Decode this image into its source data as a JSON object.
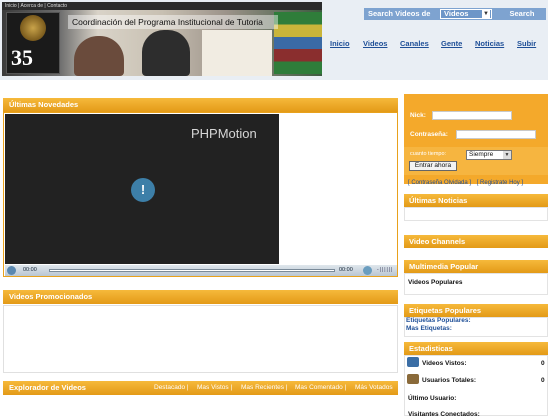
{
  "banner": {
    "top_strip": "Inicio | Acerca de | Contacto",
    "logo_number": "35",
    "title": "Coordinación del Programa Institucional de Tutoria"
  },
  "search": {
    "label": "Search Videos de",
    "selected": "Videos",
    "button": "Search"
  },
  "nav": [
    "Inicio",
    "Videos",
    "Canales",
    "Gente",
    "Noticias",
    "Subir"
  ],
  "main": {
    "novedades_title": "Últimas Novedades",
    "player": {
      "brand": "PHPMotion",
      "time_start": "00:00",
      "time_end": "00:00"
    },
    "promo_title": "Videos Promocionados",
    "explorer_title": "Explorador de Videos",
    "explorer_links": [
      "Destacado |",
      "Mas Vistos |",
      "Mas Recientes |",
      "Mas Comentado |",
      "Más Votados"
    ]
  },
  "login": {
    "nick_label": "Nick:",
    "password_label": "Contraseña:",
    "remember_label": "cuanto tiempo:",
    "remember_value": "Siempre",
    "submit": "Entrar ahora",
    "forgot_link": "[ Contraseña Olvidada ]",
    "register_link": "[ Registrate Hoy ]"
  },
  "sidebar": {
    "news_title": "Últimas Noticias",
    "channels_title": "Video Channels",
    "multimedia_title": "Multimedia Popular",
    "multimedia_item": "Videos Populares",
    "tags_title": "Etiquetas Populares",
    "tags_link1": "Etiquetas Populares:",
    "tags_link2": "Mas Etiquetas:",
    "stats_title": "Estadisticas",
    "stats": [
      {
        "label": "Videos Vistos:",
        "value": "0"
      },
      {
        "label": "Usuarios Totales:",
        "value": "0"
      },
      {
        "label": "Último Usuario:",
        "value": ""
      },
      {
        "label": "Visitantes Conectados:",
        "value": ""
      }
    ]
  }
}
